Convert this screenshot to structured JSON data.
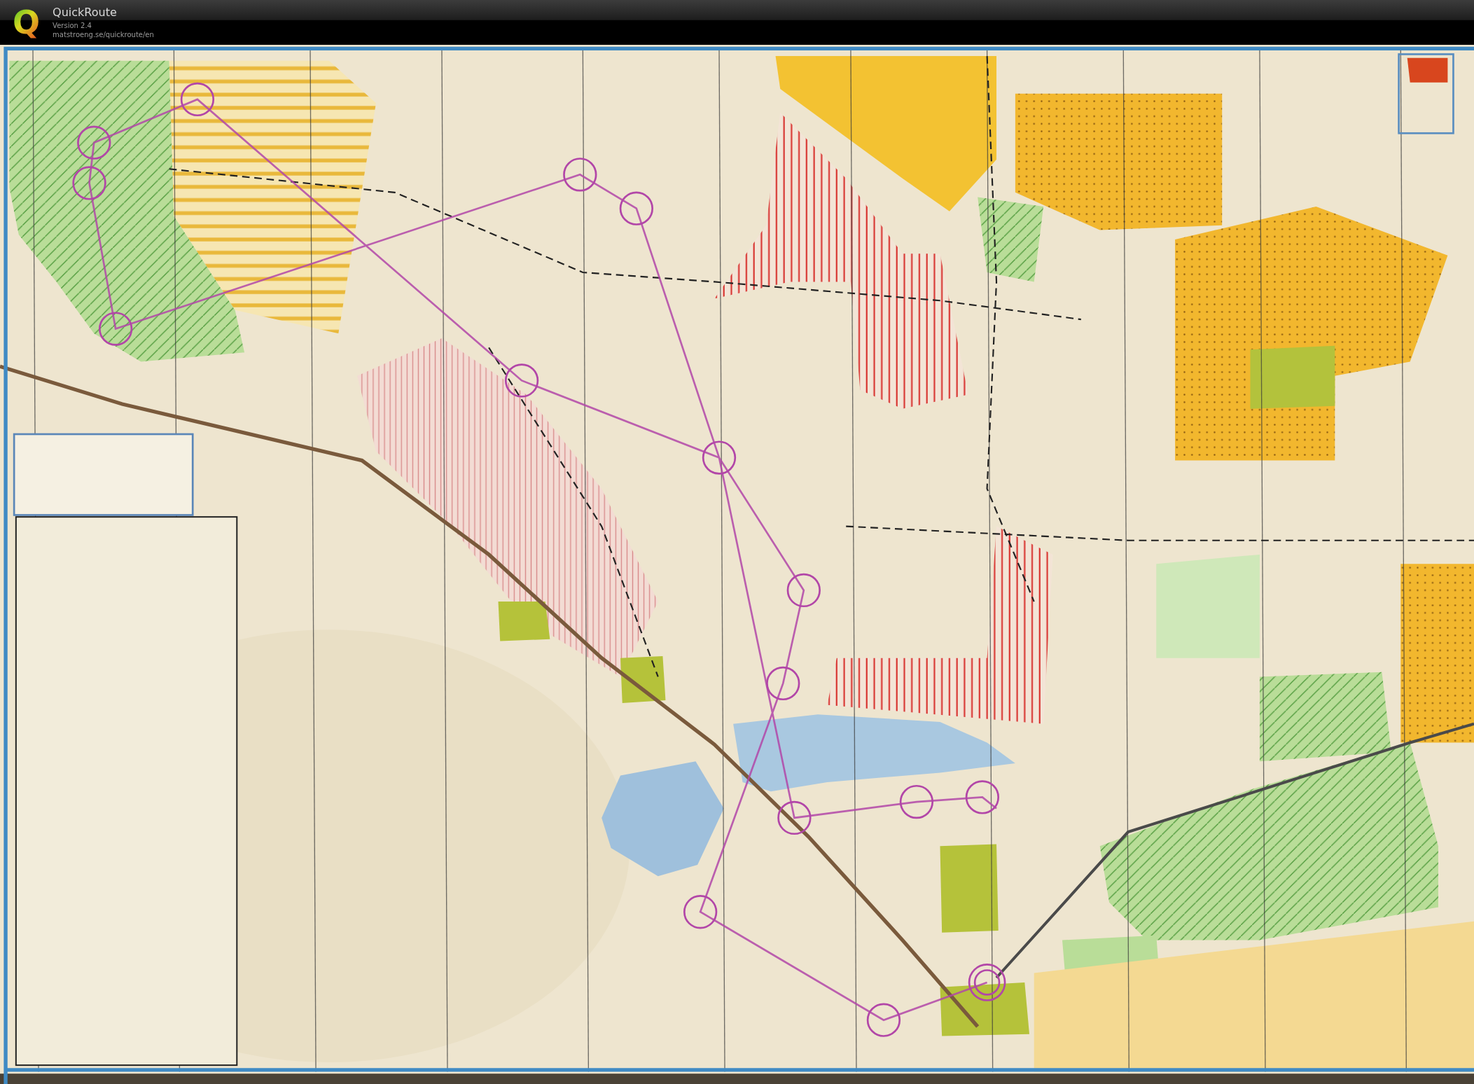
{
  "window": {
    "logo": "Q",
    "title": "QuickRoute",
    "version": "Version 2.4",
    "url": "matstroeng.se/quickroute/en"
  }
}
